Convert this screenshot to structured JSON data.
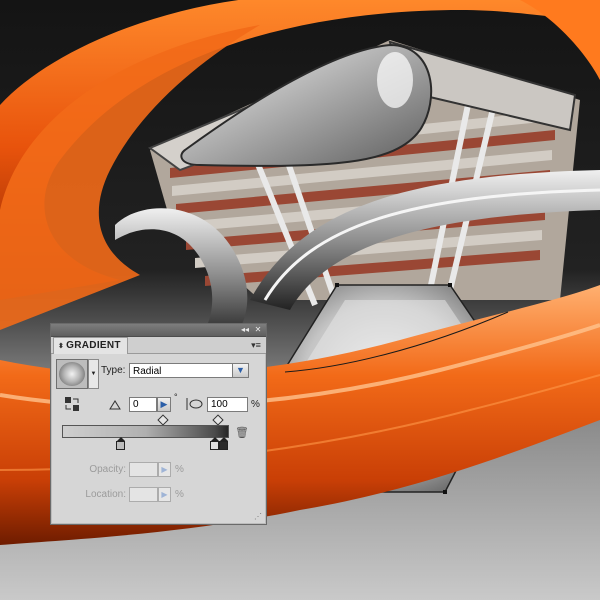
{
  "panel": {
    "title": "GRADIENT",
    "collapse_icon": "◂◂",
    "close_icon": "✕",
    "menu_icon": "▾≡"
  },
  "type_row": {
    "label": "Type:",
    "value": "Radial"
  },
  "angle": {
    "value": "0",
    "unit_symbol": "°"
  },
  "aspect_ratio": {
    "value": "100",
    "unit": "%"
  },
  "gradient_stops_fraction": [
    0.35,
    0.92,
    1.0
  ],
  "opacity": {
    "label": "Opacity:",
    "unit": "%"
  },
  "location": {
    "label": "Location:",
    "unit": "%"
  },
  "colors": {
    "orange": "#e8530c",
    "background_dark": "#1a1a1a",
    "panel_bg": "#d6d6d6"
  }
}
